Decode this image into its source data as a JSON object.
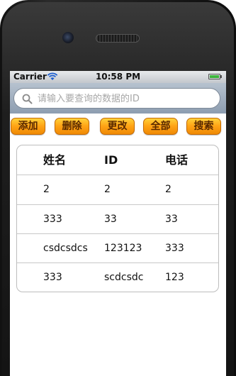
{
  "status_bar": {
    "carrier": "Carrier",
    "time": "10:58 PM"
  },
  "search": {
    "placeholder": "请输入要查询的数据的ID",
    "value": ""
  },
  "toolbar": {
    "add_label": "添加",
    "delete_label": "删除",
    "update_label": "更改",
    "all_label": "全部",
    "search_label": "搜索"
  },
  "table": {
    "headers": [
      "姓名",
      "ID",
      "电话"
    ],
    "rows": [
      [
        "2",
        "2",
        "2"
      ],
      [
        "333",
        "33",
        "33"
      ],
      [
        "csdcsdcs",
        "123123",
        "333"
      ],
      [
        "333",
        "scdcsdc",
        "123"
      ]
    ]
  },
  "colors": {
    "button_orange": "#ffa214",
    "battery_green": "#3db53d",
    "search_bar_blue": "#8d9db0"
  }
}
